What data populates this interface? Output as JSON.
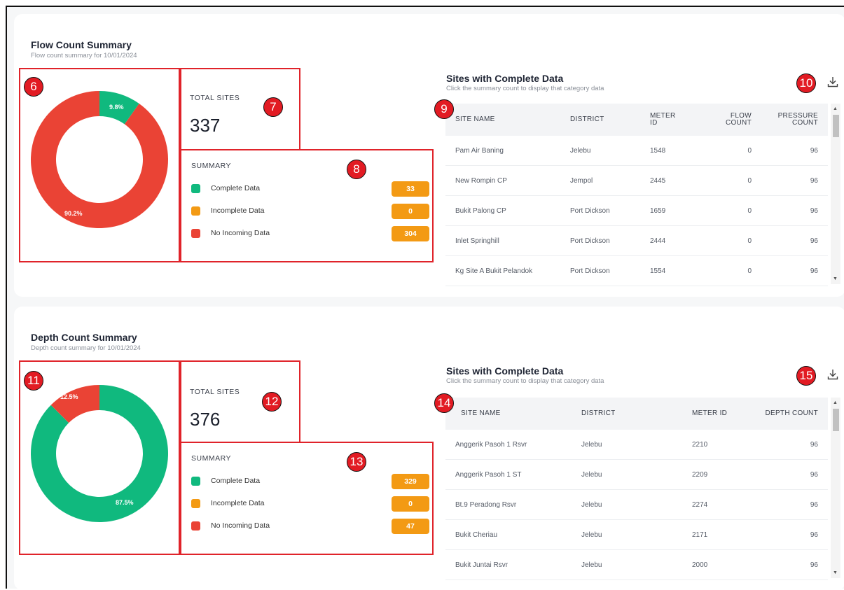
{
  "flow": {
    "title": "Flow Count Summary",
    "subtitle": "Flow count summary for 10/01/2024",
    "donut": {
      "complete_pct_label": "9.8%",
      "nodata_pct_label": "90.2%",
      "complete_fraction": 0.098,
      "nodata_fraction": 0.902
    },
    "total_label": "TOTAL SITES",
    "total_value": "337",
    "summary_label": "SUMMARY",
    "legend": [
      {
        "label": "Complete Data",
        "count": "33",
        "color": "#10b97e"
      },
      {
        "label": "Incomplete Data",
        "count": "0",
        "color": "#f39a14"
      },
      {
        "label": "No Incoming Data",
        "count": "304",
        "color": "#ea4335"
      }
    ],
    "table_title": "Sites with Complete Data",
    "table_subtitle": "Click the summary count to display that category data",
    "columns": [
      "SITE NAME",
      "DISTRICT",
      "METER ID",
      "FLOW COUNT",
      "PRESSURE COUNT"
    ],
    "rows": [
      [
        "Pam Air Baning",
        "Jelebu",
        "1548",
        "0",
        "96"
      ],
      [
        "New Rompin CP",
        "Jempol",
        "2445",
        "0",
        "96"
      ],
      [
        "Bukit Palong CP",
        "Port Dickson",
        "1659",
        "0",
        "96"
      ],
      [
        "Inlet Springhill",
        "Port Dickson",
        "2444",
        "0",
        "96"
      ],
      [
        "Kg Site A Bukit Pelandok",
        "Port Dickson",
        "1554",
        "0",
        "96"
      ]
    ],
    "badges": [
      "6",
      "7",
      "8",
      "9",
      "10"
    ]
  },
  "depth": {
    "title": "Depth Count Summary",
    "subtitle": "Depth count summary for 10/01/2024",
    "donut": {
      "nodata_pct_label": "12.5%",
      "complete_pct_label": "87.5%",
      "complete_fraction": 0.875,
      "nodata_fraction": 0.125
    },
    "total_label": "TOTAL SITES",
    "total_value": "376",
    "summary_label": "SUMMARY",
    "legend": [
      {
        "label": "Complete Data",
        "count": "329",
        "color": "#10b97e"
      },
      {
        "label": "Incomplete Data",
        "count": "0",
        "color": "#f39a14"
      },
      {
        "label": "No Incoming Data",
        "count": "47",
        "color": "#ea4335"
      }
    ],
    "table_title": "Sites with Complete Data",
    "table_subtitle": "Click the summary count to display that category data",
    "columns": [
      "SITE NAME",
      "DISTRICT",
      "METER ID",
      "DEPTH COUNT"
    ],
    "rows": [
      [
        "Anggerik Pasoh 1 Rsvr",
        "Jelebu",
        "2210",
        "96"
      ],
      [
        "Anggerik Pasoh 1 ST",
        "Jelebu",
        "2209",
        "96"
      ],
      [
        "Bt.9 Peradong Rsvr",
        "Jelebu",
        "2274",
        "96"
      ],
      [
        "Bukit Cheriau",
        "Jelebu",
        "2171",
        "96"
      ],
      [
        "Bukit Juntai Rsvr",
        "Jelebu",
        "2000",
        "96"
      ]
    ],
    "badges": [
      "11",
      "12",
      "13",
      "14",
      "15"
    ]
  },
  "icons": {
    "download": "download-icon",
    "scroll_up": "▲",
    "scroll_down": "▼"
  }
}
